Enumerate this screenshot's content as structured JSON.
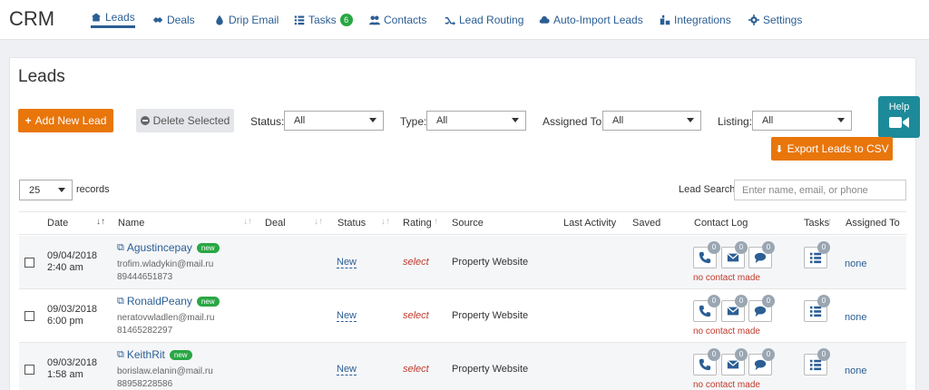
{
  "nav": {
    "brand": "CRM",
    "items": [
      {
        "label": "Leads",
        "icon": "leads-icon"
      },
      {
        "label": "Deals",
        "icon": "deals-icon"
      },
      {
        "label": "Drip Email",
        "icon": "drip-icon"
      },
      {
        "label": "Tasks",
        "icon": "tasks-icon",
        "badge": "6"
      },
      {
        "label": "Contacts",
        "icon": "contacts-icon"
      },
      {
        "label": "Lead Routing",
        "icon": "routing-icon"
      },
      {
        "label": "Auto-Import Leads",
        "icon": "cloud-icon"
      },
      {
        "label": "Integrations",
        "icon": "integrations-icon"
      },
      {
        "label": "Settings",
        "icon": "gear-icon"
      }
    ]
  },
  "page": {
    "title": "Leads",
    "add_label": "Add New Lead",
    "delete_label": "Delete Selected",
    "export_label": "Export Leads to CSV",
    "help_label": "Help"
  },
  "filters": {
    "status_label": "Status:",
    "status_value": "All",
    "type_label": "Type:",
    "type_value": "All",
    "assigned_label": "Assigned To:",
    "assigned_value": "All",
    "listing_label": "Listing:",
    "listing_value": "All"
  },
  "records": {
    "value": "25",
    "label": "records"
  },
  "search": {
    "label": "Lead Search",
    "placeholder": "Enter name, email, or phone"
  },
  "table": {
    "headers": {
      "date": "Date",
      "name": "Name",
      "deal": "Deal",
      "status": "Status",
      "rating": "Rating",
      "source": "Source",
      "activity": "Last Activity",
      "saved": "Saved",
      "contact": "Contact Log",
      "tasks": "Tasks",
      "assigned": "Assigned To"
    },
    "rows": [
      {
        "date": "09/04/2018",
        "time": "2:40 am",
        "name": "Agustincepay",
        "badge": "new",
        "email": "trofim.wladykin@mail.ru",
        "phone": "89444651873",
        "status": "New",
        "rating": "select",
        "source": "Property Website",
        "calls": "0",
        "emails": "0",
        "messages": "0",
        "no_contact": "no contact made",
        "tasks": "0",
        "assigned": "none"
      },
      {
        "date": "09/03/2018",
        "time": "6:00 pm",
        "name": "RonaldPeany",
        "badge": "new",
        "email": "neratovwladlen@mail.ru",
        "phone": "81465282297",
        "status": "New",
        "rating": "select",
        "source": "Property Website",
        "calls": "0",
        "emails": "0",
        "messages": "0",
        "no_contact": "no contact made",
        "tasks": "0",
        "assigned": "none"
      },
      {
        "date": "09/03/2018",
        "time": "1:58 am",
        "name": "KeithRit",
        "badge": "new",
        "email": "borislaw.elanin@mail.ru",
        "phone": "88958228586",
        "status": "New",
        "rating": "select",
        "source": "Property Website",
        "calls": "0",
        "emails": "0",
        "messages": "0",
        "no_contact": "no contact made",
        "tasks": "0",
        "assigned": "none"
      }
    ]
  },
  "colors": {
    "primary": "#2b5e94",
    "orange": "#e8760b",
    "green": "#29a744",
    "teal": "#1d8a99",
    "red": "#c0392b"
  }
}
